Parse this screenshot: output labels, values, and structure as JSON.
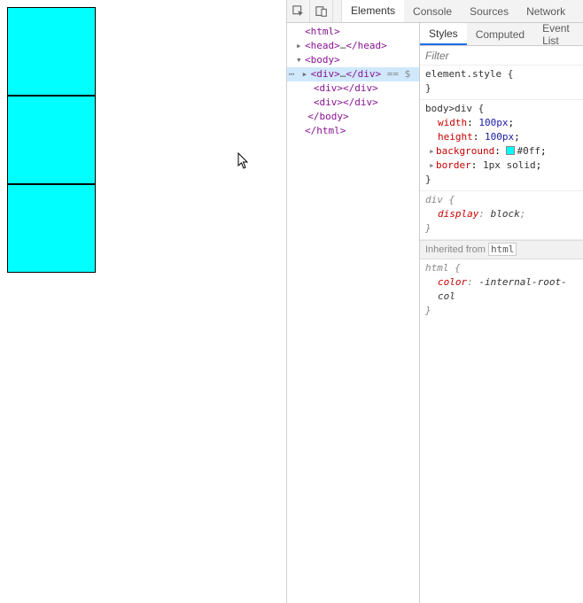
{
  "devtools": {
    "tabs": {
      "elements": "Elements",
      "console": "Console",
      "sources": "Sources",
      "network": "Network"
    },
    "dom": {
      "line_html_open": "<html>",
      "line_head": "<head>…</head>",
      "line_body_open": "<body>",
      "line_div_sel": "<div>…</div>",
      "line_div_sel_suffix": " == $",
      "line_div_1": "<div></div>",
      "line_div_2": "<div></div>",
      "line_body_close": "</body>",
      "line_html_close": "</html>"
    },
    "styles": {
      "tabs": {
        "styles": "Styles",
        "computed": "Computed",
        "eventlist": "Event List"
      },
      "filter_placeholder": "Filter",
      "rules": {
        "element_style_selector": "element.style",
        "rule2_selector": "body>div",
        "rule2_props": {
          "p1_name": "width",
          "p1_value": "100px",
          "p2_name": "height",
          "p2_value": "100px",
          "p3_name": "background",
          "p3_value": "#0ff",
          "p4_name": "border",
          "p4_value": "1px solid"
        },
        "rule3_selector": "div",
        "rule3_props": {
          "p1_name": "display",
          "p1_value": "block"
        },
        "inherited_label": "Inherited from",
        "inherited_link": "html",
        "rule4_selector": "html",
        "rule4_props": {
          "p1_name": "color",
          "p1_value": "-internal-root-col"
        }
      },
      "swatch_color": "#0ff"
    }
  },
  "page_boxes": {
    "count": 3
  }
}
